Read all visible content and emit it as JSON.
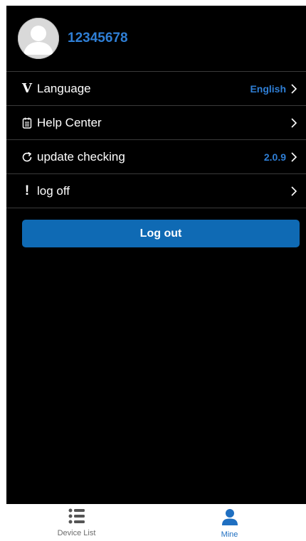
{
  "profile": {
    "username": "12345678",
    "avatar_icon": "user-avatar-icon"
  },
  "menu": [
    {
      "icon": "language-v-icon",
      "icon_glyph": "V",
      "label": "Language",
      "value": "English"
    },
    {
      "icon": "help-document-icon",
      "label": "Help Center",
      "value": ""
    },
    {
      "icon": "refresh-icon",
      "label": "update checking",
      "value": "2.0.9"
    },
    {
      "icon": "exclamation-icon",
      "icon_glyph": "!",
      "label": "log off",
      "value": ""
    }
  ],
  "logout_label": "Log out",
  "tabs": [
    {
      "label": "Device List",
      "icon": "list-icon",
      "active": false
    },
    {
      "label": "Mine",
      "icon": "person-icon",
      "active": true
    }
  ],
  "colors": {
    "accent": "#2f7fd6",
    "button": "#0f6ab4",
    "background": "#000000",
    "divider": "#3a3a3a"
  }
}
